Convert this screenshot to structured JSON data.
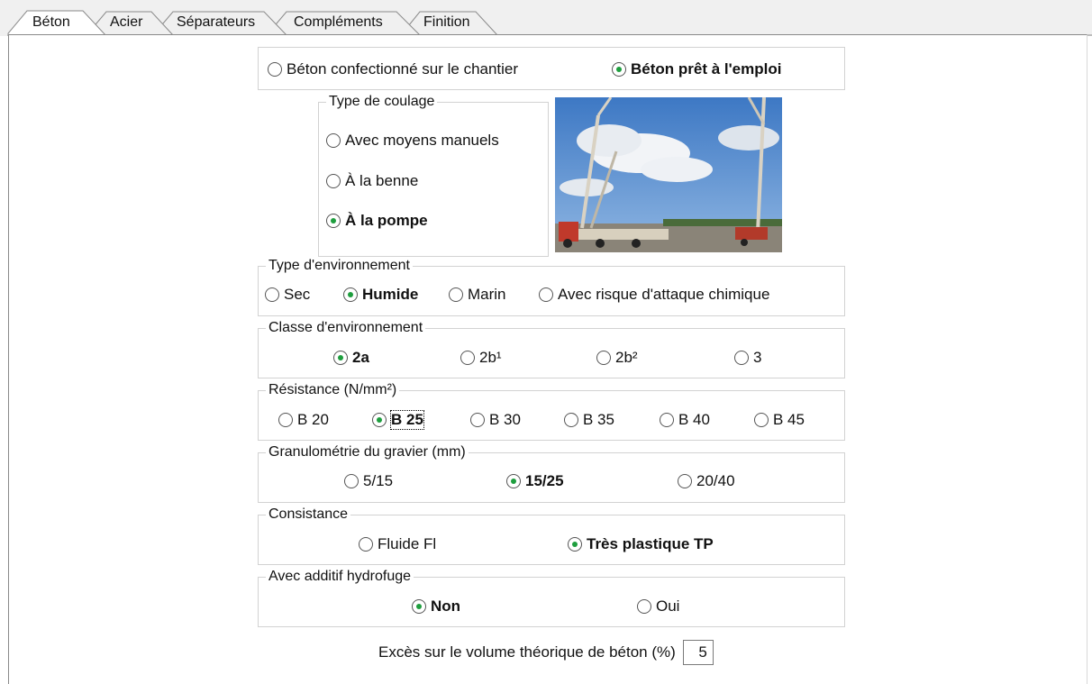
{
  "tabs": [
    {
      "label": "Béton",
      "active": true
    },
    {
      "label": "Acier",
      "active": false
    },
    {
      "label": "Séparateurs",
      "active": false
    },
    {
      "label": "Compléments",
      "active": false
    },
    {
      "label": "Finition",
      "active": false
    }
  ],
  "beton_source": {
    "options": [
      "Béton confectionné sur le chantier",
      "Béton prêt à l'emploi"
    ],
    "selected": "Béton prêt à l'emploi"
  },
  "coulage": {
    "title": "Type de coulage",
    "options": [
      "Avec moyens manuels",
      "À la benne",
      "À la pompe"
    ],
    "selected": "À la pompe"
  },
  "environnement": {
    "title": "Type d'environnement",
    "options": [
      "Sec",
      "Humide",
      "Marin",
      "Avec risque d'attaque chimique"
    ],
    "selected": "Humide"
  },
  "classe": {
    "title": "Classe d'environnement",
    "options": [
      "2a",
      "2b¹",
      "2b²",
      "3"
    ],
    "selected": "2a"
  },
  "resistance": {
    "title": "Résistance (N/mm²)",
    "options": [
      "B 20",
      "B 25",
      "B 30",
      "B 35",
      "B 40",
      "B 45"
    ],
    "selected": "B 25"
  },
  "granulometrie": {
    "title": "Granulométrie du gravier (mm)",
    "options": [
      "5/15",
      "15/25",
      "20/40"
    ],
    "selected": "15/25"
  },
  "consistance": {
    "title": "Consistance",
    "options": [
      "Fluide Fl",
      "Très plastique TP"
    ],
    "selected": "Très plastique TP"
  },
  "hydrofuge": {
    "title": "Avec additif hydrofuge",
    "options": [
      "Non",
      "Oui"
    ],
    "selected": "Non"
  },
  "exces": {
    "label": "Excès sur le volume théorique de béton (%)",
    "value": "5"
  },
  "colors": {
    "radio_dot": "#1e9e3e",
    "tabstrip_bg": "#f0f0f0",
    "group_border": "#d2d2d2"
  }
}
